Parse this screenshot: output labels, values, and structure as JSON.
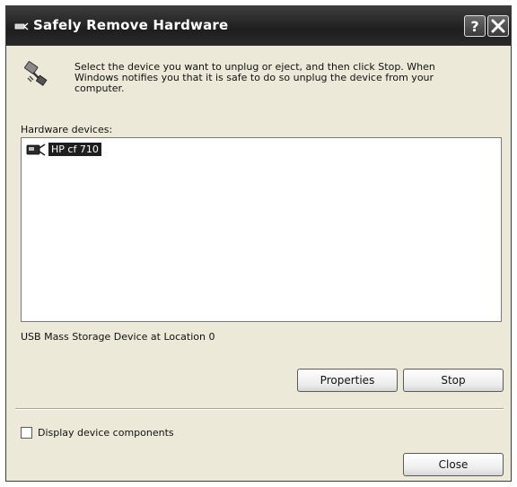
{
  "window": {
    "title": "Safely Remove Hardware"
  },
  "instruction": "Select the device you want to unplug or eject, and then click Stop. When Windows notifies you that it is safe to do so unplug the device from your computer.",
  "hardware": {
    "label": "Hardware devices:",
    "devices": [
      {
        "name": "HP cf 710",
        "selected": true,
        "icon": "usb-device-icon"
      }
    ]
  },
  "status_text": "USB Mass Storage Device at Location 0",
  "buttons": {
    "properties": "Properties",
    "stop": "Stop",
    "close": "Close"
  },
  "checkbox": {
    "label": "Display device components",
    "checked": false
  }
}
